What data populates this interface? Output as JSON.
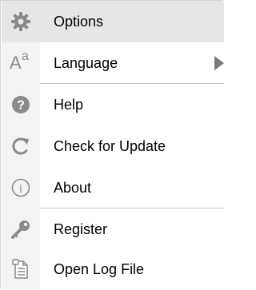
{
  "menu": {
    "items": [
      {
        "label": "Options",
        "icon": "gear-icon"
      },
      {
        "label": "Language",
        "icon": "language-icon",
        "icon_text_big": "A",
        "icon_text_small": "a"
      },
      {
        "label": "Help",
        "icon": "help-icon",
        "icon_text": "?"
      },
      {
        "label": "Check for Update",
        "icon": "refresh-icon"
      },
      {
        "label": "About",
        "icon": "info-icon",
        "icon_text": "i"
      },
      {
        "label": "Register",
        "icon": "key-icon"
      },
      {
        "label": "Open Log File",
        "icon": "log-file-icon"
      }
    ]
  },
  "colors": {
    "hover_bg": "#e6e6e6",
    "gutter_bg": "#f3f3f3",
    "icon_gray": "#8a8a8a",
    "separator": "#c8c8c8",
    "submenu_arrow": "#7a7a7a"
  }
}
